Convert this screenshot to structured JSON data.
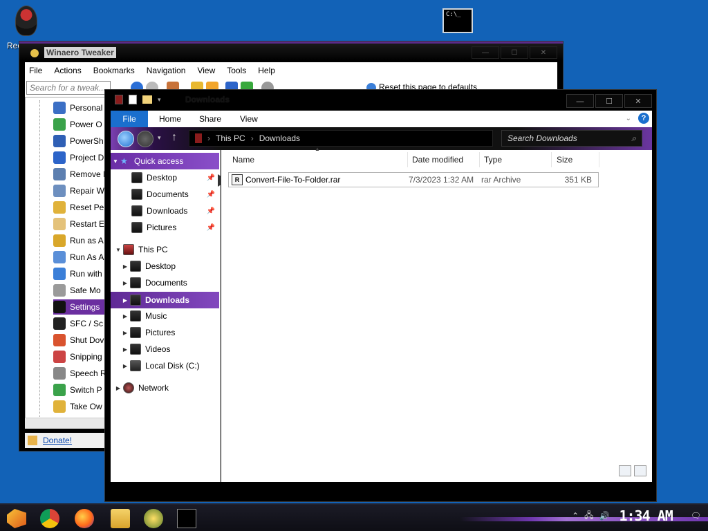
{
  "desktop": {
    "recycle_label": "Rec"
  },
  "tweaker": {
    "title": "Winaero Tweaker",
    "menu": [
      "File",
      "Actions",
      "Bookmarks",
      "Navigation",
      "View",
      "Tools",
      "Help"
    ],
    "search_placeholder": "Search for a tweak...",
    "reset_label": "Reset this page to defaults",
    "tree_items": [
      "Personal",
      "Power O",
      "PowerSh",
      "Project D",
      "Remove I",
      "Repair W",
      "Reset Pe",
      "Restart E",
      "Run as A",
      "Run As A",
      "Run with",
      "Safe Mo",
      "Settings",
      "SFC / Sc",
      "Shut Dov",
      "Snipping",
      "Speech R",
      "Switch P",
      "Take Ow"
    ],
    "selected_index": 12,
    "donate": "Donate!"
  },
  "explorer": {
    "title": "Downloads",
    "ribbon_tabs": [
      "File",
      "Home",
      "Share",
      "View"
    ],
    "path": [
      "This PC",
      "Downloads"
    ],
    "search_placeholder": "Search Downloads",
    "quick_access": "Quick access",
    "quick_items": [
      "Desktop",
      "Documents",
      "Downloads",
      "Pictures"
    ],
    "this_pc": "This PC",
    "pc_items": [
      "Desktop",
      "Documents",
      "Downloads",
      "Music",
      "Pictures",
      "Videos",
      "Local Disk (C:)"
    ],
    "network": "Network",
    "columns": [
      "Name",
      "Date modified",
      "Type",
      "Size"
    ],
    "files": [
      {
        "name": "Convert-File-To-Folder.rar",
        "date": "7/3/2023 1:32 AM",
        "type": "rar Archive",
        "size": "351 KB"
      }
    ]
  },
  "taskbar": {
    "clock": "1:34 AM"
  }
}
